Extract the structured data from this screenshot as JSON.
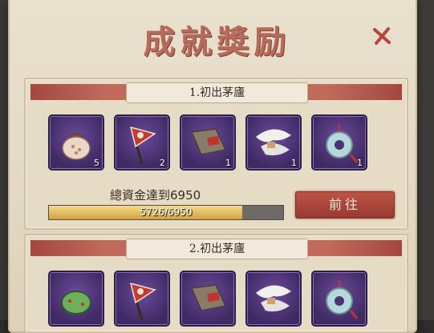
{
  "title": "成就獎励",
  "colors": {
    "accent_red": "#b76b5a",
    "item_bg": "#4a3373",
    "progress_fill": "#e1b35c"
  },
  "achievements": [
    {
      "name": "1.初出茅廬",
      "items": [
        {
          "icon": "coin-pouch-icon",
          "qty": "5"
        },
        {
          "icon": "red-banner-icon",
          "qty": "2"
        },
        {
          "icon": "sealed-book-icon",
          "qty": "1"
        },
        {
          "icon": "white-fur-scarf-icon",
          "qty": "1"
        },
        {
          "icon": "jade-pendant-icon",
          "qty": "1"
        }
      ],
      "goal_text": "總資金達到6950",
      "progress_text": "5726/6950",
      "progress_fraction": 0.824,
      "button_label": "前往"
    },
    {
      "name": "2.初出茅廬",
      "items": [
        {
          "icon": "green-pouch-icon"
        },
        {
          "icon": "red-banner-icon"
        },
        {
          "icon": "sealed-book-icon"
        },
        {
          "icon": "white-fur-scarf-icon"
        },
        {
          "icon": "jade-pendant-icon"
        }
      ]
    }
  ]
}
